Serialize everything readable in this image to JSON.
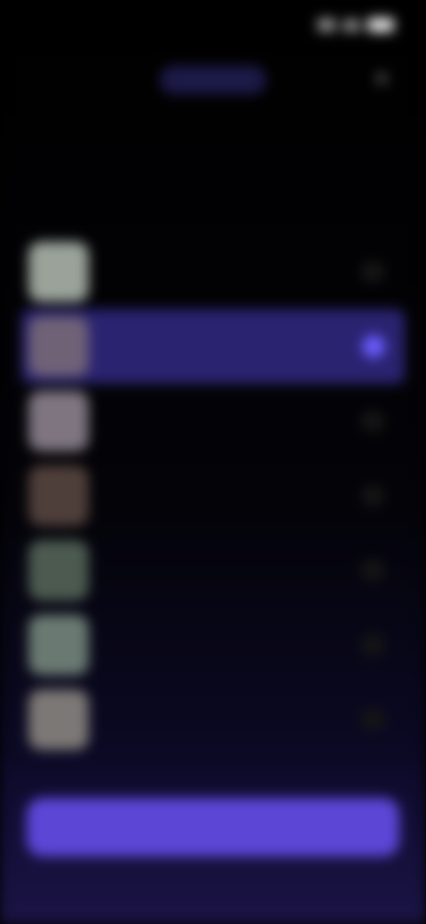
{
  "status_bar": {
    "time": ""
  },
  "nav": {
    "title": ""
  },
  "heading": {
    "text": ""
  },
  "users": [
    {
      "name": "",
      "avatar_color": "#9aa29a",
      "selected": false
    },
    {
      "name": "",
      "avatar_color": "#6f6277",
      "selected": true
    },
    {
      "name": "",
      "avatar_color": "#7e7580",
      "selected": false
    },
    {
      "name": "",
      "avatar_color": "#4f3f3a",
      "selected": false
    },
    {
      "name": "",
      "avatar_color": "#4c5a50",
      "selected": false
    },
    {
      "name": "",
      "avatar_color": "#6a7a72",
      "selected": false
    },
    {
      "name": "",
      "avatar_color": "#7c7876",
      "selected": false
    }
  ],
  "actions": {
    "primary_label": ""
  },
  "colors": {
    "accent": "#5b46d6",
    "selected_row": "#2a2370",
    "background": "#000000"
  },
  "icons": {
    "close": "close-icon",
    "signal": "signal-icon",
    "wifi": "wifi-icon",
    "battery": "battery-icon"
  }
}
